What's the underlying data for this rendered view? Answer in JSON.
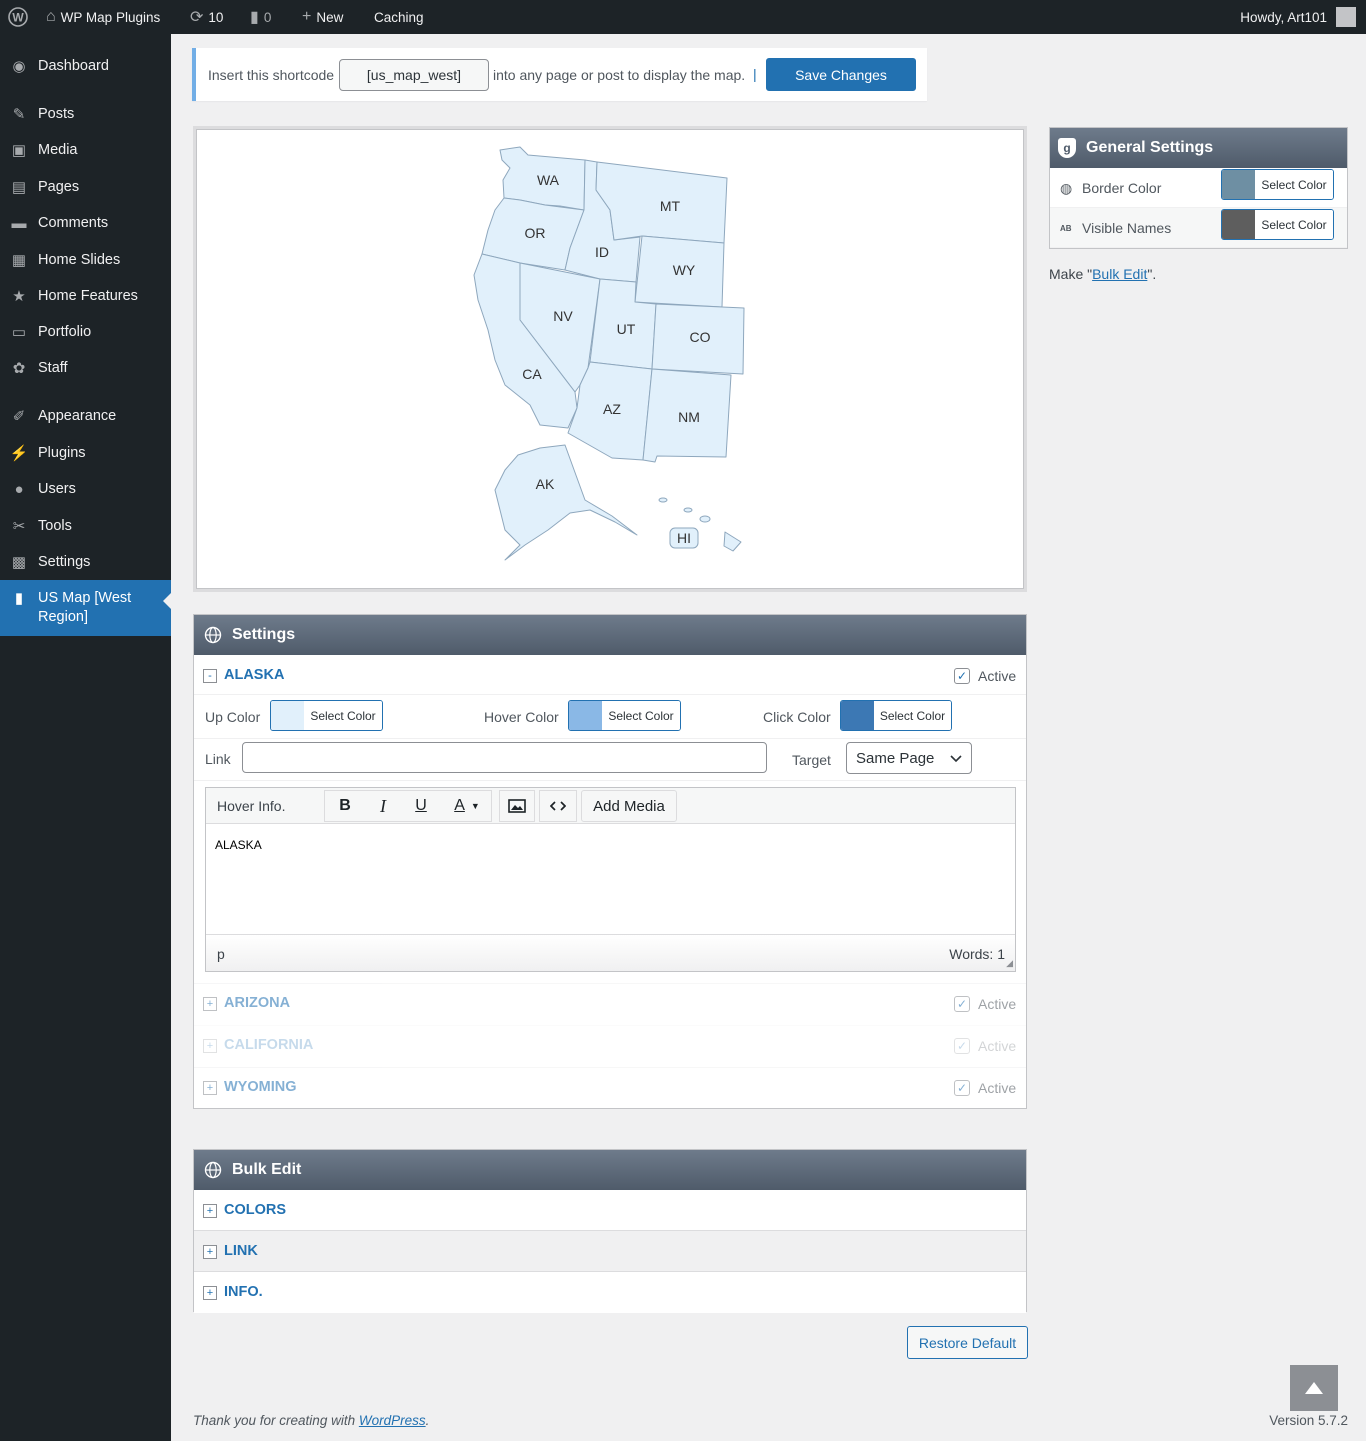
{
  "admin_bar": {
    "site_name": "WP Map Plugins",
    "updates_count": "10",
    "comments_count": "0",
    "new_label": "New",
    "caching_label": "Caching",
    "greeting": "Howdy, Art101"
  },
  "sidebar": {
    "items": [
      {
        "label": "Dashboard",
        "icon": "dashboard-icon"
      },
      {
        "label": "Posts",
        "icon": "pushpin-icon"
      },
      {
        "label": "Media",
        "icon": "media-icon"
      },
      {
        "label": "Pages",
        "icon": "pages-icon"
      },
      {
        "label": "Comments",
        "icon": "comment-icon"
      },
      {
        "label": "Home Slides",
        "icon": "slides-icon"
      },
      {
        "label": "Home Features",
        "icon": "star-icon"
      },
      {
        "label": "Portfolio",
        "icon": "portfolio-icon"
      },
      {
        "label": "Staff",
        "icon": "staff-icon"
      },
      {
        "label": "Appearance",
        "icon": "brush-icon"
      },
      {
        "label": "Plugins",
        "icon": "plugin-icon"
      },
      {
        "label": "Users",
        "icon": "user-icon"
      },
      {
        "label": "Tools",
        "icon": "wrench-icon"
      },
      {
        "label": "Settings",
        "icon": "settings-icon"
      },
      {
        "label": "US Map [West Region]",
        "icon": "map-pin-icon"
      }
    ]
  },
  "shortcode_bar": {
    "prefix": "Insert this shortcode",
    "shortcode": "[us_map_west]",
    "suffix": "into any page or post to display the map.",
    "separator": "|",
    "save_label": "Save Changes"
  },
  "map": {
    "states": [
      "WA",
      "OR",
      "ID",
      "MT",
      "WY",
      "NV",
      "UT",
      "CO",
      "CA",
      "AZ",
      "NM",
      "AK",
      "HI"
    ],
    "fill": "#e1f0fb",
    "stroke": "#8ea7bd",
    "label_color": "#333333"
  },
  "general_settings": {
    "title": "General Settings",
    "rows": [
      {
        "label": "Border Color",
        "button": "Select Color",
        "color": "#6e8fa3",
        "icon": "palette-icon"
      },
      {
        "label": "Visible Names",
        "button": "Select Color",
        "color": "#5e5e5e",
        "icon": "text-ab-icon"
      }
    ],
    "bulk_prefix": "Make \"",
    "bulk_link": "Bulk Edit",
    "bulk_suffix": "\"."
  },
  "settings_panel": {
    "title": "Settings",
    "state": {
      "toggle": "-",
      "name": "ALASKA",
      "active_label": "Active",
      "up_color_label": "Up Color",
      "up_color": "#e1f0fb",
      "hover_color_label": "Hover Color",
      "hover_color": "#8ab8e6",
      "click_color_label": "Click Color",
      "click_color": "#3c78b4",
      "select_color": "Select Color",
      "link_label": "Link",
      "link_value": "",
      "target_label": "Target",
      "target_value": "Same Page",
      "editor_label": "Hover Info.",
      "editor_buttons": [
        "B",
        "I",
        "U",
        "A"
      ],
      "add_media": "Add Media",
      "editor_content": "ALASKA",
      "path_label": "p",
      "word_count": "Words: 1"
    },
    "collapsed": [
      {
        "toggle": "+",
        "name": "ARIZONA",
        "active_label": "Active"
      },
      {
        "toggle": "+",
        "name": "CALIFORNIA",
        "active_label": "Active"
      },
      {
        "toggle": "+",
        "name": "WYOMING",
        "active_label": "Active"
      }
    ]
  },
  "bulk_edit": {
    "title": "Bulk Edit",
    "rows": [
      {
        "toggle": "+",
        "name": "COLORS"
      },
      {
        "toggle": "+",
        "name": "LINK"
      },
      {
        "toggle": "+",
        "name": "INFO."
      }
    ]
  },
  "restore_label": "Restore Default",
  "footer": {
    "thanks_prefix": "Thank you for creating with ",
    "wp_link": "WordPress",
    "thanks_suffix": ".",
    "version": "Version 5.7.2"
  }
}
